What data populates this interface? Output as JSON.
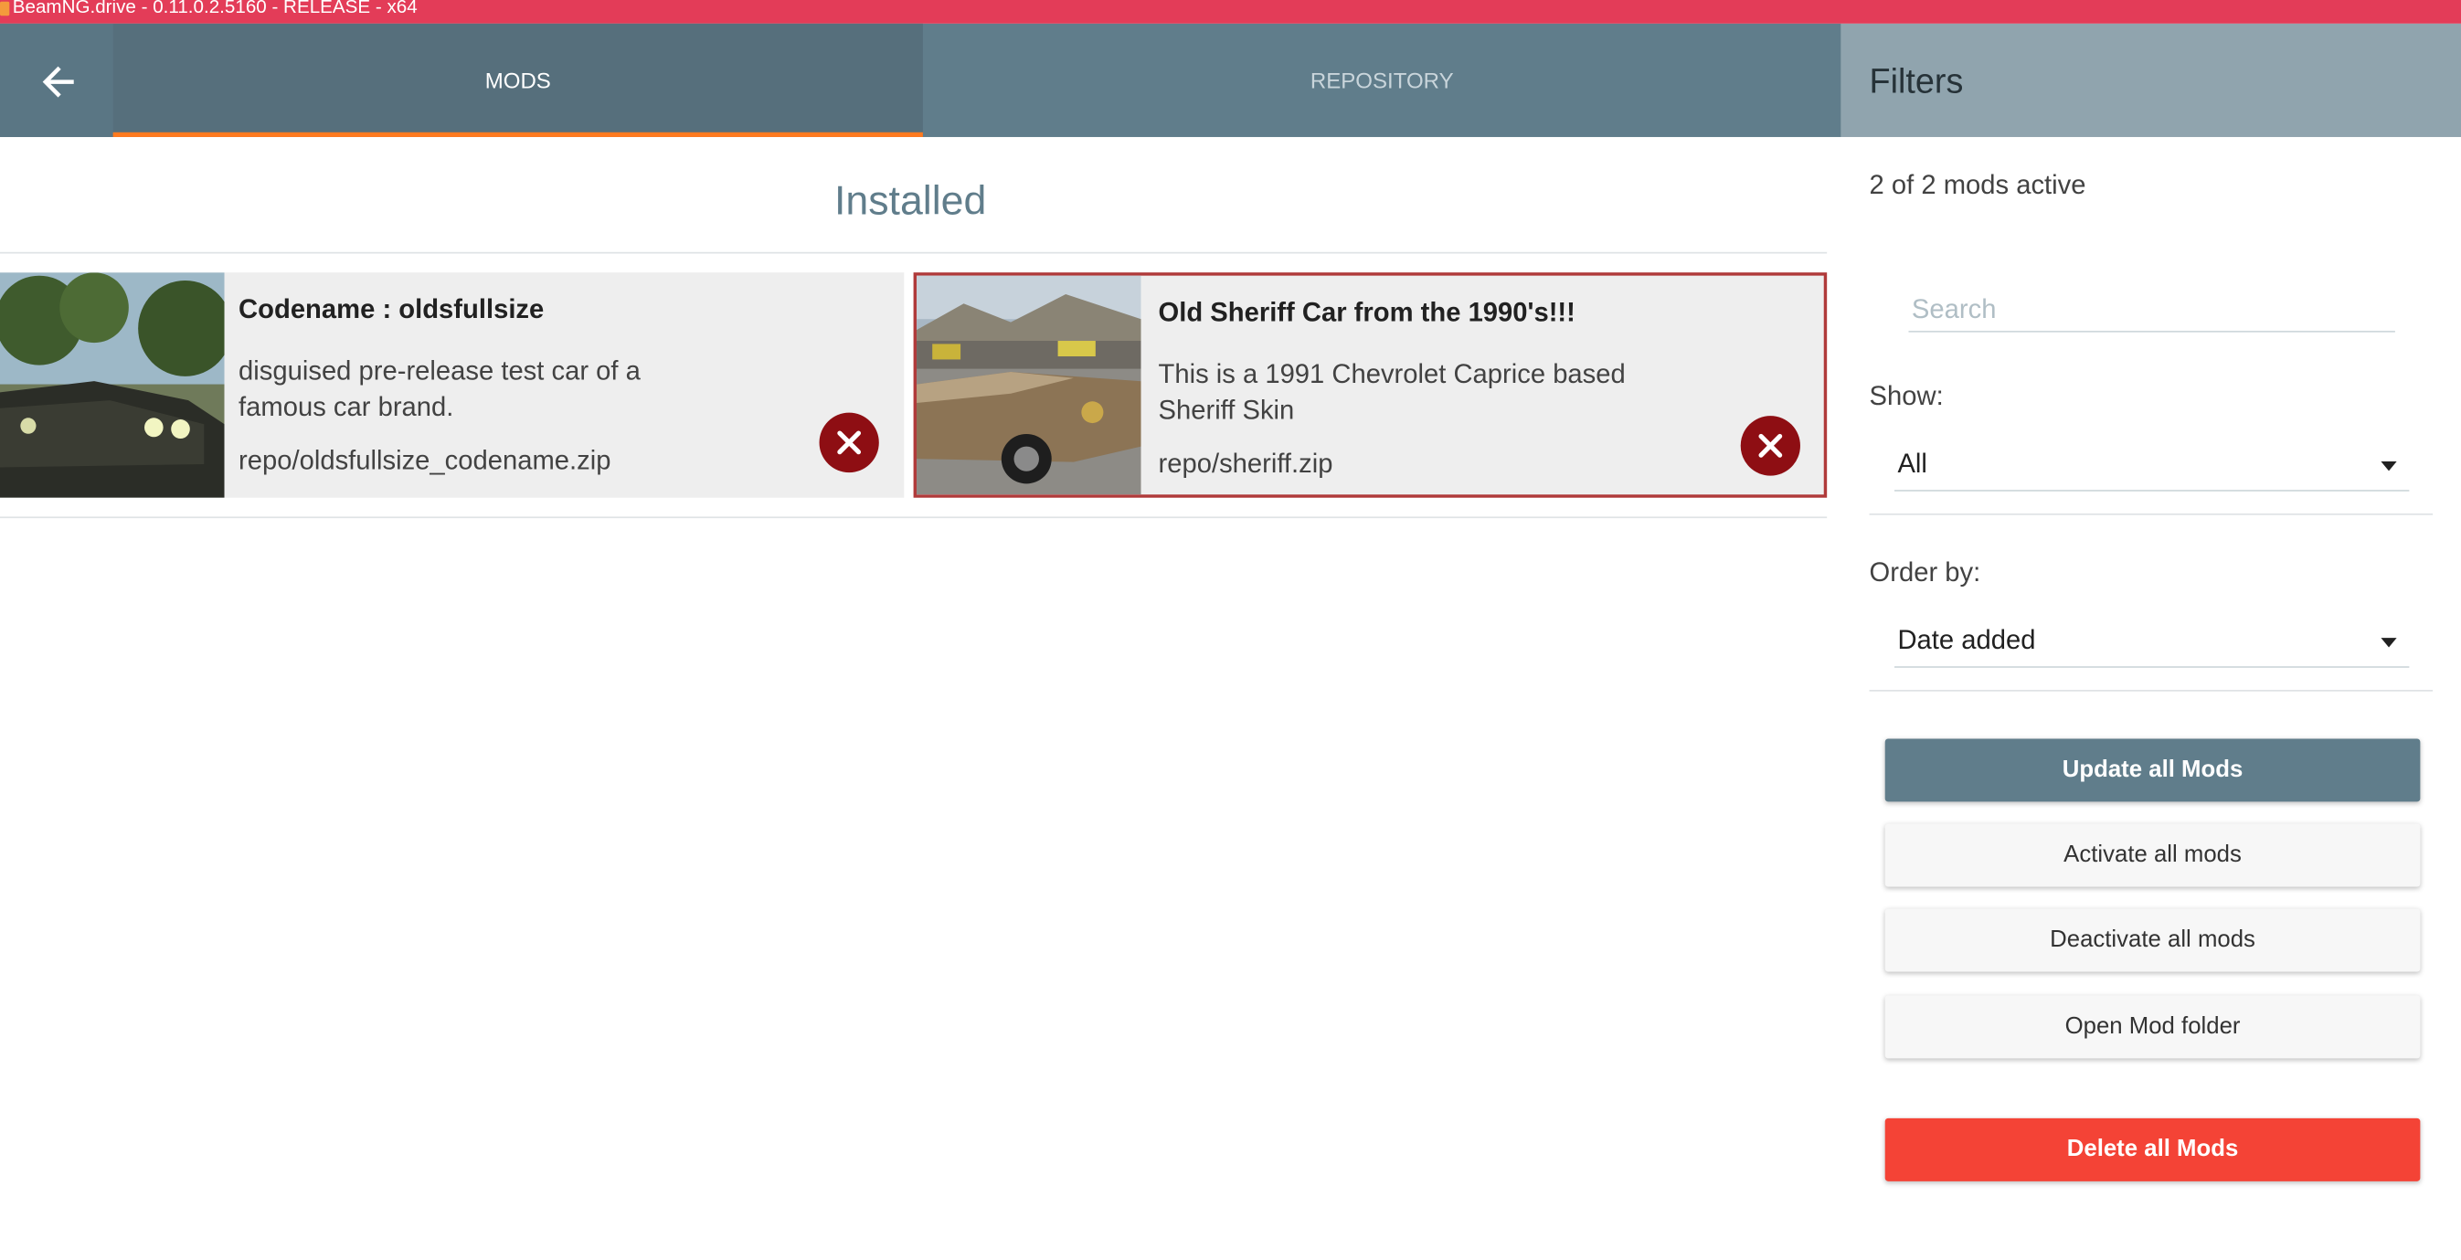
{
  "window": {
    "title": "BeamNG.drive - 0.11.0.2.5160 - RELEASE - x64"
  },
  "tabs": [
    {
      "label": "MODS",
      "active": true
    },
    {
      "label": "REPOSITORY",
      "active": false
    }
  ],
  "main": {
    "section_title": "Installed",
    "mods": [
      {
        "name": "Codename : oldsfullsize",
        "description": "disguised pre-release test car of a famous car brand.",
        "path": "repo/oldsfullsize_codename.zip",
        "selected": false
      },
      {
        "name": "Old Sheriff Car from the 1990's!!!",
        "description": "This is a 1991 Chevrolet Caprice based Sheriff Skin",
        "path": "repo/sheriff.zip",
        "selected": true
      }
    ]
  },
  "filters": {
    "title": "Filters",
    "status": "2 of 2 mods active",
    "search_placeholder": "Search",
    "show_label": "Show:",
    "show_value": "All",
    "order_label": "Order by:",
    "order_value": "Date added",
    "buttons": {
      "update": "Update all Mods",
      "activate": "Activate all mods",
      "deactivate": "Deactivate all mods",
      "open_folder": "Open Mod folder",
      "delete": "Delete all Mods"
    }
  },
  "colors": {
    "titlebar": "#e33c58",
    "header": "#607d8b",
    "tab_indicator": "#ff7a1f",
    "delete": "#f44336",
    "remove_icon": "#8e0e13"
  }
}
